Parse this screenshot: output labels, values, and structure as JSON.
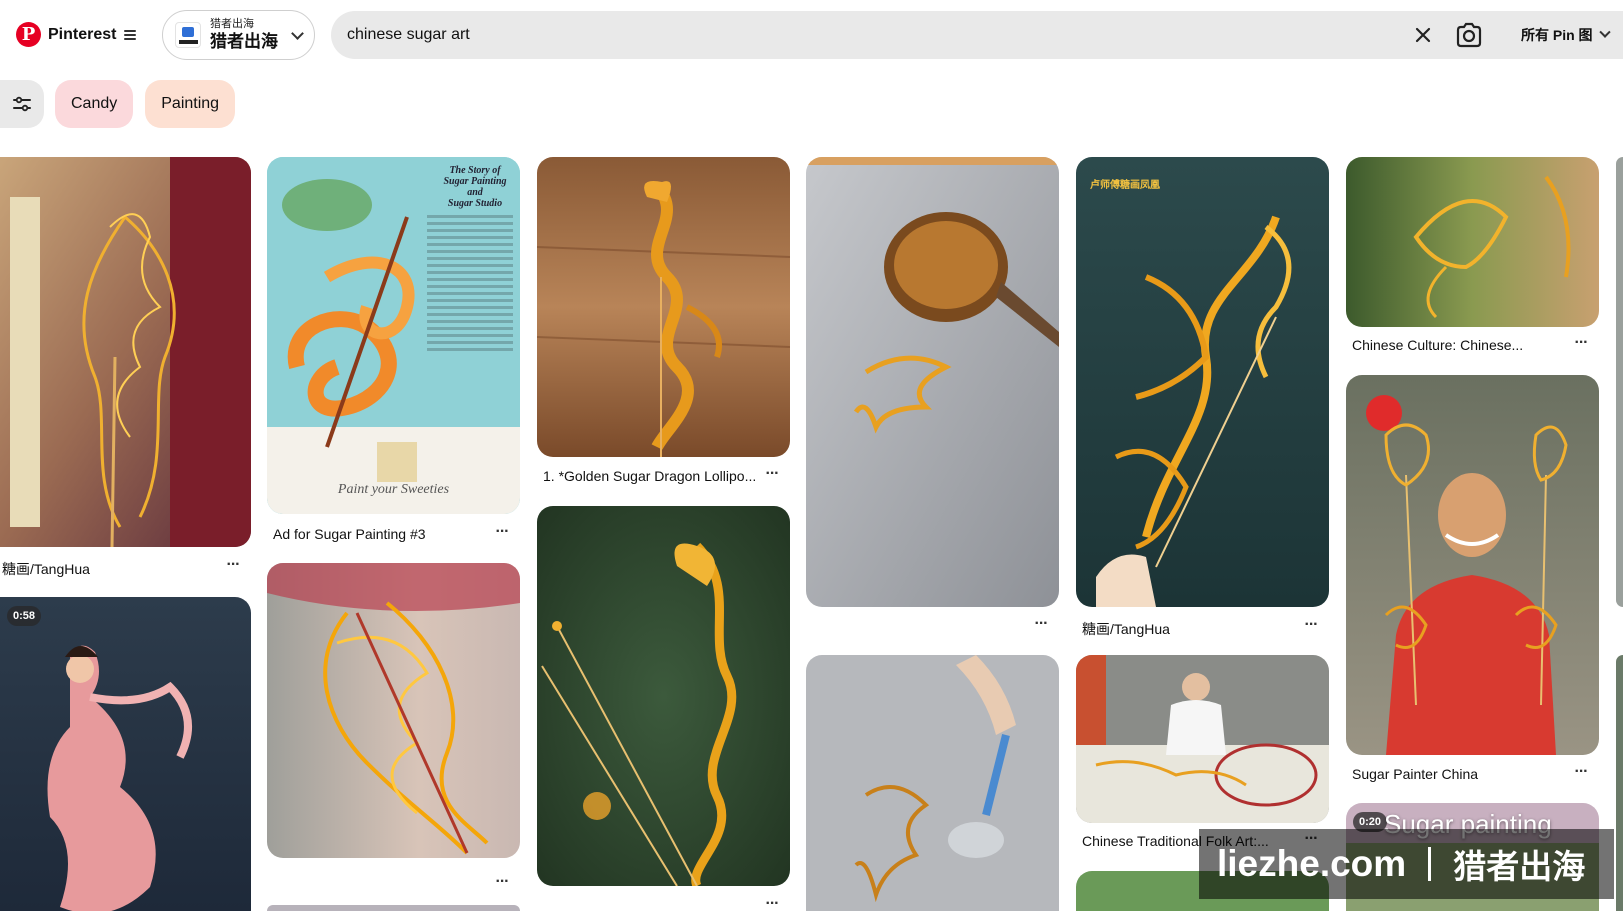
{
  "header": {
    "brand": "Pinterest",
    "account_small": "猎者出海",
    "account_big": "猎者出海",
    "search_value": "chinese sugar art",
    "scope_label": "所有 Pin 图"
  },
  "filters": {
    "chips": [
      "Candy",
      "Painting"
    ]
  },
  "pins": [
    {
      "title": "糖画/TangHua",
      "caption_lines": []
    },
    {
      "title": "",
      "badge": "0:58"
    },
    {
      "title": "Ad for Sugar Painting #3",
      "card_text": [
        "The Story of",
        "Sugar Painting",
        "and",
        "Sugar Studio"
      ],
      "card_footer": "Paint your Sweeties"
    },
    {
      "title": ""
    },
    {
      "title": "1. *Golden Sugar Dragon Lollipo..."
    },
    {
      "title": ""
    },
    {
      "title": ""
    },
    {
      "title": ""
    },
    {
      "title": "糖画/TangHua",
      "corner_text": "卢师傅糖画凤凰"
    },
    {
      "title": "Chinese Traditional Folk Art:..."
    },
    {
      "title": "Chinese Culture: Chinese..."
    },
    {
      "title": "Sugar Painter China"
    },
    {
      "title": "",
      "badge": "0:20",
      "overlay_text": "Sugar painting"
    }
  ],
  "watermark": {
    "left": "liezhe.com",
    "right": "猎者出海"
  },
  "colors": {
    "brand": "#e60023",
    "search_bg": "#e9e9e9",
    "chip_candy": "#fbd9dc",
    "chip_painting": "#fde0d2"
  }
}
